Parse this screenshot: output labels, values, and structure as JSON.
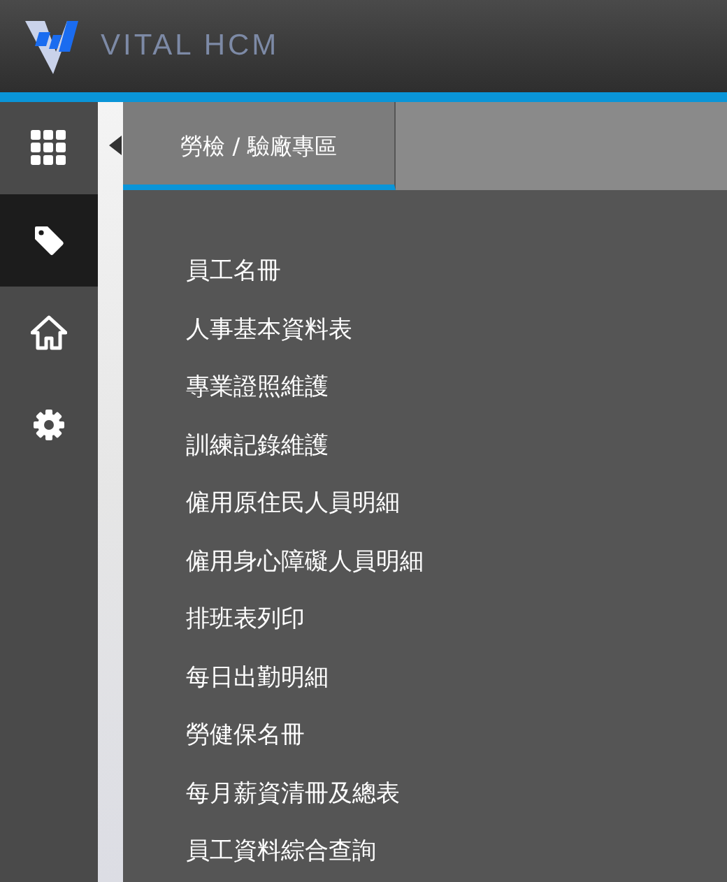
{
  "header": {
    "logo_text": "VITAL HCM"
  },
  "sidebar": {
    "items": [
      {
        "kind": "apps",
        "selected": false
      },
      {
        "kind": "tag",
        "selected": true
      },
      {
        "kind": "home",
        "selected": false
      },
      {
        "kind": "settings",
        "selected": false
      }
    ]
  },
  "panel": {
    "tabs": [
      {
        "label": "勞檢 / 驗廠專區",
        "selected": true
      }
    ],
    "items": [
      "員工名冊",
      "人事基本資料表",
      "專業證照維護",
      "訓練記錄維護",
      "僱用原住民人員明細",
      "僱用身心障礙人員明細",
      "排班表列印",
      "每日出勤明細",
      "勞健保名冊",
      "每月薪資清冊及總表",
      "員工資料綜合查詢"
    ]
  }
}
